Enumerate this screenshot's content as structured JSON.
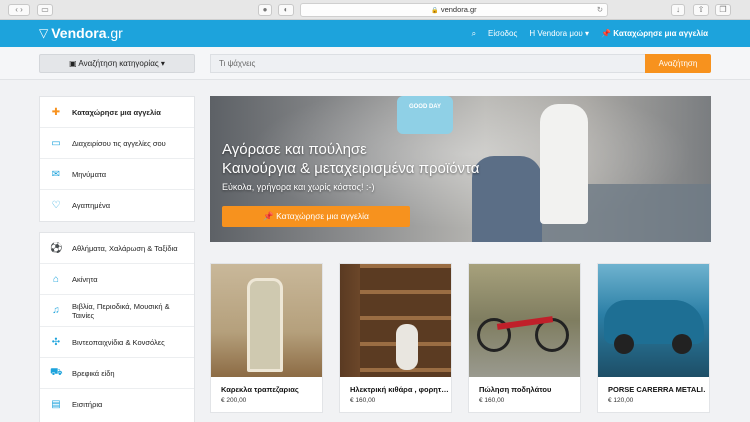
{
  "browser": {
    "url": "vendora.gr"
  },
  "header": {
    "logo": "Vendora",
    "logo_tld": ".gr",
    "login": "Είσοδος",
    "about": "Η Vendora μου",
    "post_ad": "Καταχώρησε μια αγγελία"
  },
  "search": {
    "category_label": "Αναζήτηση κατηγορίας",
    "placeholder": "Τι ψάχνεις",
    "button": "Αναζήτηση"
  },
  "sidebar": {
    "account": [
      {
        "label": "Καταχώρησε μια αγγελία",
        "icon": "pin-icon"
      },
      {
        "label": "Διαχειρίσου τις αγγελίες σου",
        "icon": "folder-icon"
      },
      {
        "label": "Μηνύματα",
        "icon": "mail-icon"
      },
      {
        "label": "Αγαπημένα",
        "icon": "heart-icon"
      }
    ],
    "categories": [
      {
        "label": "Αθλήματα, Χαλάρωση & Ταξίδια",
        "icon": "sports-icon"
      },
      {
        "label": "Ακίνητα",
        "icon": "house-icon"
      },
      {
        "label": "Βιβλία, Περιοδικά, Μουσική & Ταινίες",
        "icon": "music-icon"
      },
      {
        "label": "Βιντεοπαιχνίδια & Κονσόλες",
        "icon": "gamepad-icon"
      },
      {
        "label": "Βρεφικά είδη",
        "icon": "stroller-icon"
      },
      {
        "label": "Εισιτήρια",
        "icon": "ticket-icon"
      }
    ]
  },
  "hero": {
    "pillow": "GOOD DAY",
    "title_line1": "Αγόρασε και πούλησε",
    "title_line2": "Καινούργια & μεταχειρισμένα προϊόντα",
    "subtitle": "Εύκολα, γρήγορα και χωρίς κόστος! :-)",
    "cta": "Καταχώρησε μια αγγελία"
  },
  "listings": [
    {
      "title": "Καρεκλα τραπεζαριας",
      "price": "€ 200,00",
      "color": "#b7a07e"
    },
    {
      "title": "Ηλεκτρική κιθάρα , φορητ…",
      "price": "€ 160,00",
      "color": "#6b4a2c"
    },
    {
      "title": "Πώληση ποδηλάτου",
      "price": "€ 160,00",
      "color": "#7c7e5f"
    },
    {
      "title": "PORSE CARERRA METALI…",
      "price": "€ 120,00",
      "color": "#2b7fa6"
    }
  ],
  "colors": {
    "brand": "#1da3dc",
    "accent": "#f7921e"
  }
}
